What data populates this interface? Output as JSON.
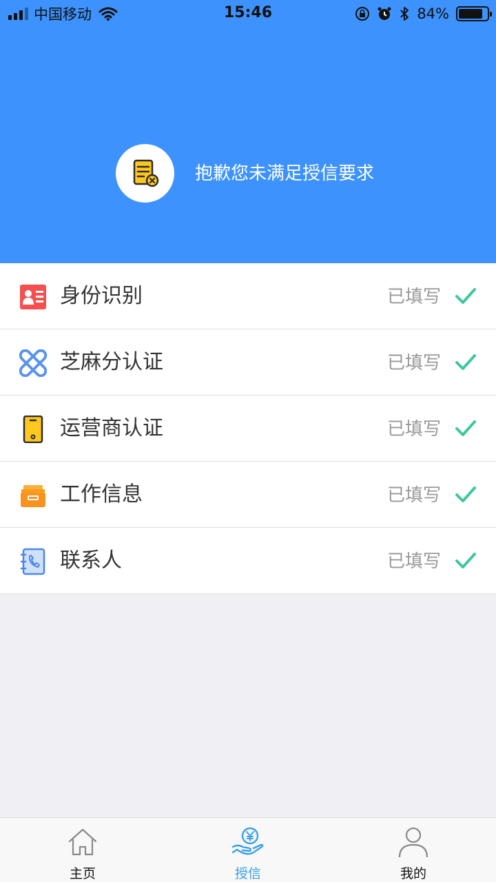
{
  "status_bar": {
    "carrier": "中国移动",
    "time": "15:46",
    "battery_percent": "84%",
    "battery_level": 0.84,
    "icons": [
      "signal-icon",
      "wifi-icon",
      "orientation-lock-icon",
      "alarm-icon",
      "bluetooth-icon",
      "battery-icon"
    ]
  },
  "header": {
    "message": "抱歉您未满足授信要求",
    "icon": "document-rejected-icon",
    "background": "#3d92fd"
  },
  "items": [
    {
      "label": "身份识别",
      "status": "已填写",
      "icon": "id-card-icon"
    },
    {
      "label": "芝麻分认证",
      "status": "已填写",
      "icon": "sesame-icon"
    },
    {
      "label": "运营商认证",
      "status": "已填写",
      "icon": "phone-icon"
    },
    {
      "label": "工作信息",
      "status": "已填写",
      "icon": "briefcase-icon"
    },
    {
      "label": "联系人",
      "status": "已填写",
      "icon": "contacts-book-icon"
    }
  ],
  "check_color": "#3ec79f",
  "tabbar": {
    "tabs": [
      {
        "label": "主页",
        "icon": "home-icon",
        "active": false
      },
      {
        "label": "授信",
        "icon": "credit-hand-icon",
        "active": true
      },
      {
        "label": "我的",
        "icon": "user-icon",
        "active": false
      }
    ],
    "active_color": "#3aa0e6"
  }
}
